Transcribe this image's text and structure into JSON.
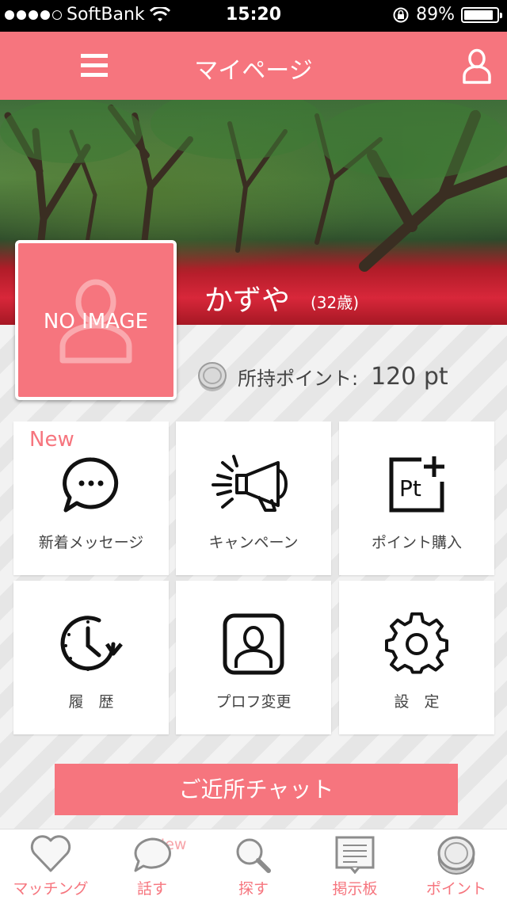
{
  "status_bar": {
    "carrier": "SoftBank",
    "time": "15:20",
    "battery": "89%",
    "battery_level": 0.89,
    "signal_bars": 4
  },
  "header": {
    "title": "マイページ",
    "menu_icon": "hamburger-menu-icon",
    "user_icon": "user-icon"
  },
  "profile": {
    "name": "かずや",
    "age": "(32歳)",
    "avatar_placeholder": "NO IMAGE"
  },
  "points": {
    "label": "所持ポイント:",
    "value": "120 pt"
  },
  "tiles": [
    {
      "label": "新着メッセージ",
      "icon": "chat-bubble-icon",
      "badge": "New"
    },
    {
      "label": "キャンペーン",
      "icon": "megaphone-icon"
    },
    {
      "label": "ポイント購入",
      "icon": "points-plus-icon"
    },
    {
      "label": "履　歴",
      "icon": "history-clock-icon"
    },
    {
      "label": "プロフ変更",
      "icon": "profile-icon"
    },
    {
      "label": "設　定",
      "icon": "gear-icon"
    }
  ],
  "chat_button": {
    "label": "ご近所チャット"
  },
  "tabbar": {
    "items": [
      {
        "label": "マッチング",
        "icon": "heart-icon"
      },
      {
        "label": "話す",
        "icon": "speech-bubble-icon",
        "badge": "New"
      },
      {
        "label": "探す",
        "icon": "search-icon"
      },
      {
        "label": "掲示板",
        "icon": "board-icon"
      },
      {
        "label": "ポイント",
        "icon": "coin-icon"
      }
    ]
  },
  "colors": {
    "accent": "#f6757e",
    "accent_light": "#f7a4a9"
  }
}
